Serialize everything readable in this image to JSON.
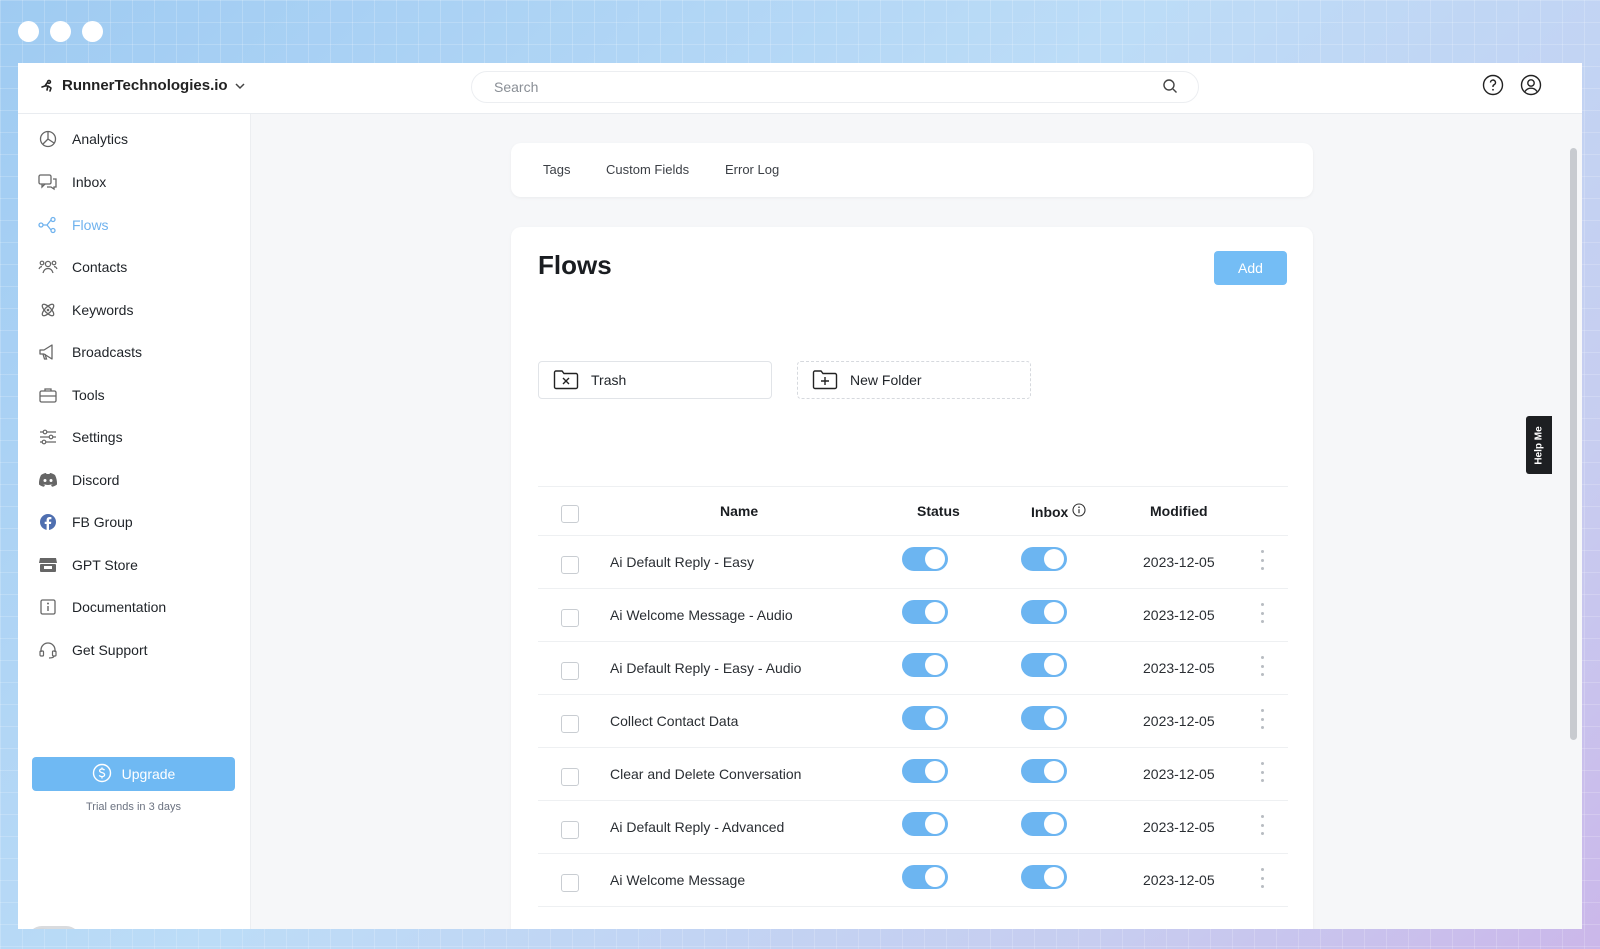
{
  "brand": {
    "name": "RunnerTechnologies.io"
  },
  "search": {
    "placeholder": "Search"
  },
  "sidebar": {
    "items": [
      {
        "label": "Analytics",
        "icon": "analytics-icon"
      },
      {
        "label": "Inbox",
        "icon": "inbox-icon"
      },
      {
        "label": "Flows",
        "icon": "flows-icon",
        "active": true
      },
      {
        "label": "Contacts",
        "icon": "contacts-icon"
      },
      {
        "label": "Keywords",
        "icon": "keywords-icon"
      },
      {
        "label": "Broadcasts",
        "icon": "megaphone-icon"
      },
      {
        "label": "Tools",
        "icon": "toolbox-icon"
      },
      {
        "label": "Settings",
        "icon": "sliders-icon"
      },
      {
        "label": "Discord",
        "icon": "discord-icon"
      },
      {
        "label": "FB Group",
        "icon": "facebook-icon"
      },
      {
        "label": "GPT Store",
        "icon": "store-icon"
      },
      {
        "label": "Documentation",
        "icon": "info-icon"
      },
      {
        "label": "Get Support",
        "icon": "headset-icon"
      }
    ],
    "upgrade_label": "Upgrade",
    "trial_text": "Trial ends in 3 days",
    "theme_toggle_on": false
  },
  "tabs": [
    "Tags",
    "Custom Fields",
    "Error Log"
  ],
  "flows": {
    "title": "Flows",
    "add_label": "Add",
    "folders": {
      "trash": "Trash",
      "new_folder": "New Folder"
    },
    "columns": {
      "name": "Name",
      "status": "Status",
      "inbox": "Inbox",
      "modified": "Modified"
    },
    "rows": [
      {
        "name": "Ai Default Reply - Easy",
        "status": true,
        "inbox": true,
        "modified": "2023-12-05"
      },
      {
        "name": "Ai Welcome Message - Audio",
        "status": true,
        "inbox": true,
        "modified": "2023-12-05"
      },
      {
        "name": "Ai Default Reply - Easy - Audio",
        "status": true,
        "inbox": true,
        "modified": "2023-12-05"
      },
      {
        "name": "Collect Contact Data",
        "status": true,
        "inbox": true,
        "modified": "2023-12-05"
      },
      {
        "name": "Clear and Delete Conversation",
        "status": true,
        "inbox": true,
        "modified": "2023-12-05"
      },
      {
        "name": "Ai Default Reply - Advanced",
        "status": true,
        "inbox": true,
        "modified": "2023-12-05"
      },
      {
        "name": "Ai Welcome Message",
        "status": true,
        "inbox": true,
        "modified": "2023-12-05"
      }
    ]
  },
  "help_me": "Help Me",
  "colors": {
    "accent": "#6fb9f3",
    "active_nav": "#6fb2ee",
    "toggle_on": "#6cb5f1"
  }
}
